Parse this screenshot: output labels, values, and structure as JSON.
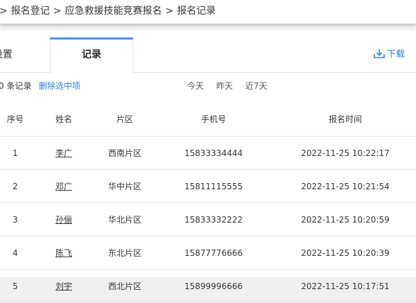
{
  "breadcrumb": {
    "items": [
      "报名登记",
      "应急救援技能竞赛报名",
      "报名记录"
    ],
    "separator": ">"
  },
  "tabs": {
    "settings_label": "设置",
    "records_label": "记录"
  },
  "download_label": "下载",
  "toolbar": {
    "count_label": "0 条记录",
    "delete_label": "删除选中项",
    "filters": [
      "今天",
      "昨天",
      "近7天"
    ]
  },
  "table": {
    "headers": [
      "序号",
      "姓名",
      "片区",
      "手机号",
      "报名时间"
    ],
    "rows": [
      {
        "idx": "1",
        "name": "李广",
        "area": "西南片区",
        "phone": "15833334444",
        "time": "2022-11-25 10:22:17"
      },
      {
        "idx": "2",
        "name": "邓广",
        "area": "华中片区",
        "phone": "15811115555",
        "time": "2022-11-25 10:21:54"
      },
      {
        "idx": "3",
        "name": "孙俪",
        "area": "华北片区",
        "phone": "15833332222",
        "time": "2022-11-25 10:20:59"
      },
      {
        "idx": "4",
        "name": "陈飞",
        "area": "东北片区",
        "phone": "15877776666",
        "time": "2022-11-25 10:20:39"
      },
      {
        "idx": "5",
        "name": "刘宇",
        "area": "西北片区",
        "phone": "15899996666",
        "time": "2022-11-25 10:17:51"
      }
    ]
  },
  "colors": {
    "accent": "#4a90e2",
    "link": "#2f7ed8",
    "border": "#e4e4e4"
  }
}
